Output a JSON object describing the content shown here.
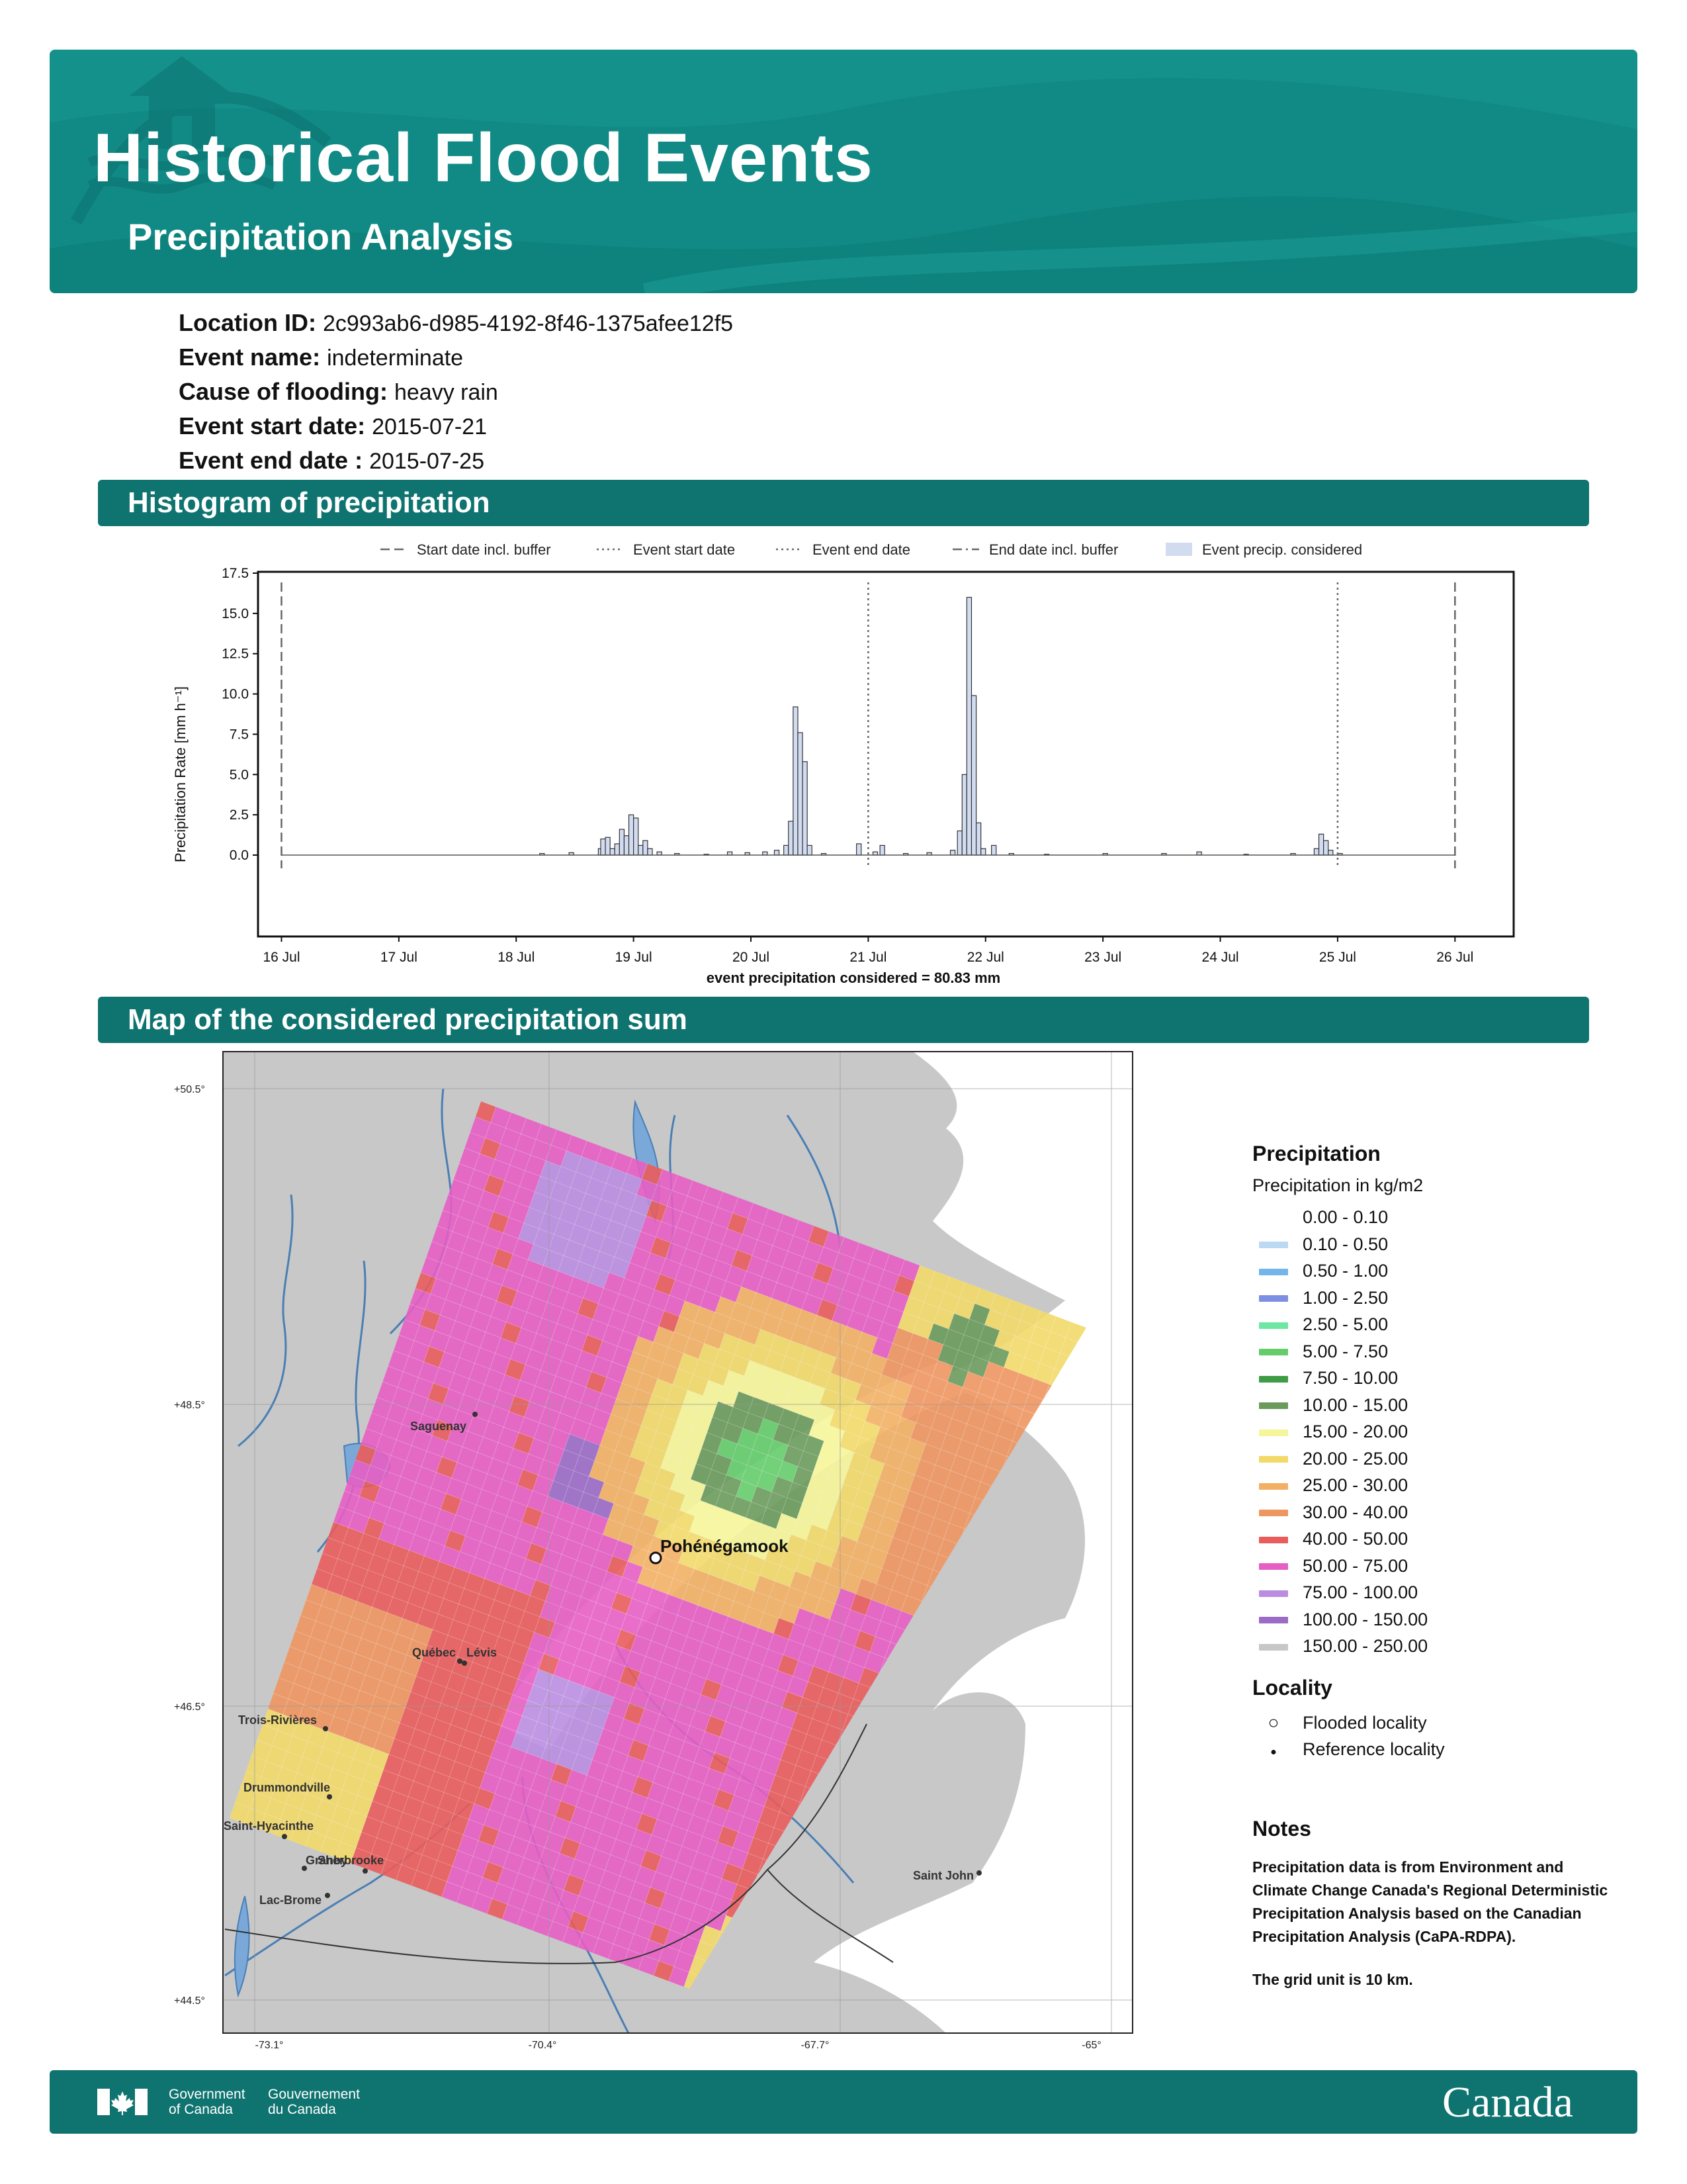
{
  "header": {
    "title": "Historical Flood Events",
    "subtitle": "Precipitation Analysis"
  },
  "event_info": [
    {
      "label": "Location ID:",
      "value": "2c993ab6-d985-4192-8f46-1375afee12f5"
    },
    {
      "label": "Event name:",
      "value": "indeterminate"
    },
    {
      "label": "Cause of flooding:",
      "value": "heavy rain"
    },
    {
      "label": "Event start date:",
      "value": "2015-07-21"
    },
    {
      "label": "Event end date :",
      "value": "2015-07-25"
    }
  ],
  "sections": {
    "histogram": "Histogram of precipitation",
    "map": "Map of the considered precipitation sum"
  },
  "chart_data": {
    "type": "bar",
    "xlabel": "event precipitation considered = 80.83 mm",
    "ylabel": "Precipitation Rate [mm h⁻¹]",
    "ylim": [
      0,
      17.5
    ],
    "yticks": [
      "0.0",
      "2.5",
      "5.0",
      "7.5",
      "10.0",
      "12.5",
      "15.0",
      "17.5"
    ],
    "xlim": [
      15.8,
      26.5
    ],
    "xticks": [
      {
        "day": 16,
        "label": "16 Jul"
      },
      {
        "day": 17,
        "label": "17 Jul"
      },
      {
        "day": 18,
        "label": "18 Jul"
      },
      {
        "day": 19,
        "label": "19 Jul"
      },
      {
        "day": 20,
        "label": "20 Jul"
      },
      {
        "day": 21,
        "label": "21 Jul"
      },
      {
        "day": 22,
        "label": "22 Jul"
      },
      {
        "day": 23,
        "label": "23 Jul"
      },
      {
        "day": 24,
        "label": "24 Jul"
      },
      {
        "day": 25,
        "label": "25 Jul"
      },
      {
        "day": 26,
        "label": "26 Jul"
      }
    ],
    "legend": [
      {
        "label": "Start date incl. buffer",
        "style": "dashed"
      },
      {
        "label": "Event start date",
        "style": "dotted"
      },
      {
        "label": "Event end date",
        "style": "dotted"
      },
      {
        "label": "End date incl. buffer",
        "style": "dashdot"
      },
      {
        "label": "Event precip. considered",
        "style": "fill"
      }
    ],
    "vlines": [
      {
        "day": 16.0,
        "style": "dashed"
      },
      {
        "day": 21.0,
        "style": "dotted"
      },
      {
        "day": 25.0,
        "style": "dotted"
      },
      {
        "day": 26.0,
        "style": "dashed"
      }
    ],
    "bars": [
      {
        "t": 18.2,
        "v": 0.1
      },
      {
        "t": 18.45,
        "v": 0.15
      },
      {
        "t": 18.7,
        "v": 0.4
      },
      {
        "t": 18.72,
        "v": 1.0
      },
      {
        "t": 18.76,
        "v": 1.1
      },
      {
        "t": 18.8,
        "v": 0.4
      },
      {
        "t": 18.84,
        "v": 0.7
      },
      {
        "t": 18.88,
        "v": 1.6
      },
      {
        "t": 18.92,
        "v": 1.2
      },
      {
        "t": 18.96,
        "v": 2.5
      },
      {
        "t": 19.0,
        "v": 2.3
      },
      {
        "t": 19.04,
        "v": 0.6
      },
      {
        "t": 19.08,
        "v": 0.9
      },
      {
        "t": 19.12,
        "v": 0.4
      },
      {
        "t": 19.2,
        "v": 0.2
      },
      {
        "t": 19.35,
        "v": 0.1
      },
      {
        "t": 19.6,
        "v": 0.05
      },
      {
        "t": 19.8,
        "v": 0.2
      },
      {
        "t": 19.95,
        "v": 0.15
      },
      {
        "t": 20.1,
        "v": 0.2
      },
      {
        "t": 20.2,
        "v": 0.3
      },
      {
        "t": 20.28,
        "v": 0.6
      },
      {
        "t": 20.32,
        "v": 2.1
      },
      {
        "t": 20.36,
        "v": 9.2
      },
      {
        "t": 20.4,
        "v": 7.6
      },
      {
        "t": 20.44,
        "v": 5.8
      },
      {
        "t": 20.48,
        "v": 0.6
      },
      {
        "t": 20.6,
        "v": 0.1
      },
      {
        "t": 20.9,
        "v": 0.7
      },
      {
        "t": 21.04,
        "v": 0.2
      },
      {
        "t": 21.1,
        "v": 0.6
      },
      {
        "t": 21.3,
        "v": 0.1
      },
      {
        "t": 21.5,
        "v": 0.15
      },
      {
        "t": 21.7,
        "v": 0.3
      },
      {
        "t": 21.76,
        "v": 1.5
      },
      {
        "t": 21.8,
        "v": 5.0
      },
      {
        "t": 21.84,
        "v": 16.0
      },
      {
        "t": 21.88,
        "v": 9.9
      },
      {
        "t": 21.92,
        "v": 2.0
      },
      {
        "t": 21.96,
        "v": 0.4
      },
      {
        "t": 22.05,
        "v": 0.6
      },
      {
        "t": 22.2,
        "v": 0.1
      },
      {
        "t": 22.5,
        "v": 0.05
      },
      {
        "t": 23.0,
        "v": 0.1
      },
      {
        "t": 23.5,
        "v": 0.1
      },
      {
        "t": 23.8,
        "v": 0.2
      },
      {
        "t": 24.2,
        "v": 0.05
      },
      {
        "t": 24.6,
        "v": 0.1
      },
      {
        "t": 24.8,
        "v": 0.4
      },
      {
        "t": 24.84,
        "v": 1.3
      },
      {
        "t": 24.88,
        "v": 0.9
      },
      {
        "t": 24.92,
        "v": 0.3
      },
      {
        "t": 25.0,
        "v": 0.1
      }
    ]
  },
  "map": {
    "lat_labels": [
      {
        "lat": 50.5,
        "label": "+50.5°"
      },
      {
        "lat": 48.5,
        "label": "+48.5°"
      },
      {
        "lat": 46.5,
        "label": "+46.5°"
      },
      {
        "lat": 44.5,
        "label": "+44.5°"
      }
    ],
    "lon_labels": [
      {
        "lon": -73.1,
        "label": "-73.1°"
      },
      {
        "lon": -70.4,
        "label": "-70.4°"
      },
      {
        "lon": -67.7,
        "label": "-67.7°"
      },
      {
        "lon": -65.0,
        "label": "-65°"
      }
    ],
    "places": [
      {
        "name": "Saguenay",
        "flooded": false
      },
      {
        "name": "Pohénégamook",
        "flooded": true
      },
      {
        "name": "Québec",
        "flooded": false
      },
      {
        "name": "Lévis",
        "flooded": false
      },
      {
        "name": "Trois-Rivières",
        "flooded": false
      },
      {
        "name": "Drummondville",
        "flooded": false
      },
      {
        "name": "Saint-Hyacinthe",
        "flooded": false
      },
      {
        "name": "Granby",
        "flooded": false
      },
      {
        "name": "Sherbrooke",
        "flooded": false
      },
      {
        "name": "Lac-Brome",
        "flooded": false
      },
      {
        "name": "Saint John",
        "flooded": false
      }
    ]
  },
  "legend": {
    "precip_title": "Precipitation",
    "precip_subtitle": "Precipitation in kg/m2",
    "classes": [
      {
        "label": "0.00 - 0.10",
        "color": "#ffffff"
      },
      {
        "label": "0.10 - 0.50",
        "color": "#bcd9f3"
      },
      {
        "label": "0.50 - 1.00",
        "color": "#74b5ec"
      },
      {
        "label": "1.00 - 2.50",
        "color": "#7d8fe3"
      },
      {
        "label": "2.50 - 5.00",
        "color": "#6fe7a3"
      },
      {
        "label": "5.00 - 7.50",
        "color": "#64cc6b"
      },
      {
        "label": "7.50 - 10.00",
        "color": "#3f9c46"
      },
      {
        "label": "10.00 - 15.00",
        "color": "#6a9a5c"
      },
      {
        "label": "15.00 - 20.00",
        "color": "#f5f599"
      },
      {
        "label": "20.00 - 25.00",
        "color": "#f2d96a"
      },
      {
        "label": "25.00 - 30.00",
        "color": "#f2b065"
      },
      {
        "label": "30.00 - 40.00",
        "color": "#ee9660"
      },
      {
        "label": "40.00 - 50.00",
        "color": "#e95c5c"
      },
      {
        "label": "50.00 - 75.00",
        "color": "#e65ec4"
      },
      {
        "label": "75.00 - 100.00",
        "color": "#b98de0"
      },
      {
        "label": "100.00 - 150.00",
        "color": "#9b6cc6"
      },
      {
        "label": "150.00 - 250.00",
        "color": "#c7c7c7"
      }
    ],
    "locality_title": "Locality",
    "locality_items": [
      {
        "label": "Flooded locality",
        "symbol": "○"
      },
      {
        "label": "Reference locality",
        "symbol": "●"
      }
    ]
  },
  "notes": {
    "title": "Notes",
    "paragraphs": [
      "Precipitation data is from Environment and Climate Change Canada's Regional Deterministic Precipitation Analysis based on the Canadian Precipitation Analysis (CaPA-RDPA).",
      "The grid unit is 10 km."
    ]
  },
  "footer": {
    "gov_en_1": "Government",
    "gov_en_2": "of Canada",
    "gov_fr_1": "Gouvernement",
    "gov_fr_2": "du Canada",
    "wordmark": "Canada"
  },
  "colors": {
    "banner": "#118a85",
    "section_bar": "#0f7470",
    "bar_fill": "#d2dcf0"
  }
}
